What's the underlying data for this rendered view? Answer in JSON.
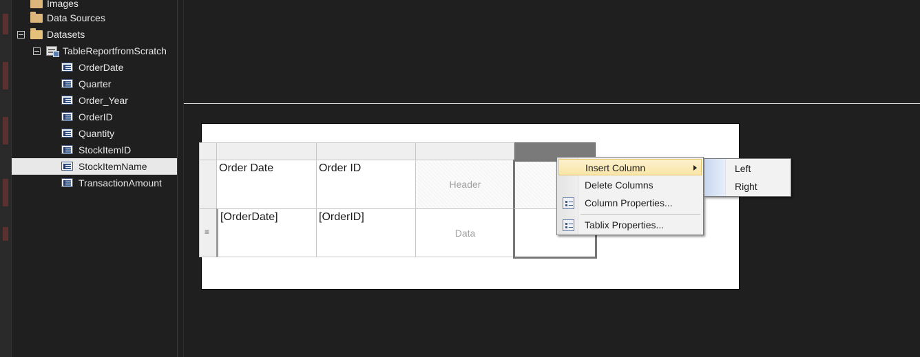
{
  "tree": {
    "items": [
      {
        "label": "Images",
        "kind": "folder"
      },
      {
        "label": "Data Sources",
        "kind": "folder"
      },
      {
        "label": "Datasets",
        "kind": "folder-open",
        "expanded": true
      },
      {
        "label": "TableReportfromScratch",
        "kind": "dataset",
        "expanded": true
      },
      {
        "label": "OrderDate",
        "kind": "field"
      },
      {
        "label": "Quarter",
        "kind": "field"
      },
      {
        "label": "Order_Year",
        "kind": "field"
      },
      {
        "label": "OrderID",
        "kind": "field"
      },
      {
        "label": "Quantity",
        "kind": "field"
      },
      {
        "label": "StockItemID",
        "kind": "field"
      },
      {
        "label": "StockItemName",
        "kind": "field",
        "selected": true
      },
      {
        "label": "TransactionAmount",
        "kind": "field"
      }
    ]
  },
  "tablix": {
    "header_row": [
      "Order Date",
      "Order ID",
      "Header",
      ""
    ],
    "data_row": [
      "[OrderDate]",
      "[OrderID]",
      "Data",
      ""
    ],
    "row_grip_glyph": "≡"
  },
  "context_menu": {
    "items": [
      {
        "label": "Insert Column",
        "has_submenu": true,
        "highlighted": true,
        "icon": ""
      },
      {
        "label": "Delete Columns",
        "icon": ""
      },
      {
        "label": "Column Properties...",
        "icon": "properties-icon"
      },
      {
        "label": "Tablix Properties...",
        "icon": "properties-icon"
      }
    ]
  },
  "submenu": {
    "items": [
      {
        "label": "Left"
      },
      {
        "label": "Right"
      }
    ]
  },
  "colors": {
    "background": "#1f1f1f",
    "tree_text": "#e8e8e8",
    "selection": "#e8e8e8",
    "menu_highlight": "#f9e5a7",
    "report_body": "#ffffff"
  }
}
